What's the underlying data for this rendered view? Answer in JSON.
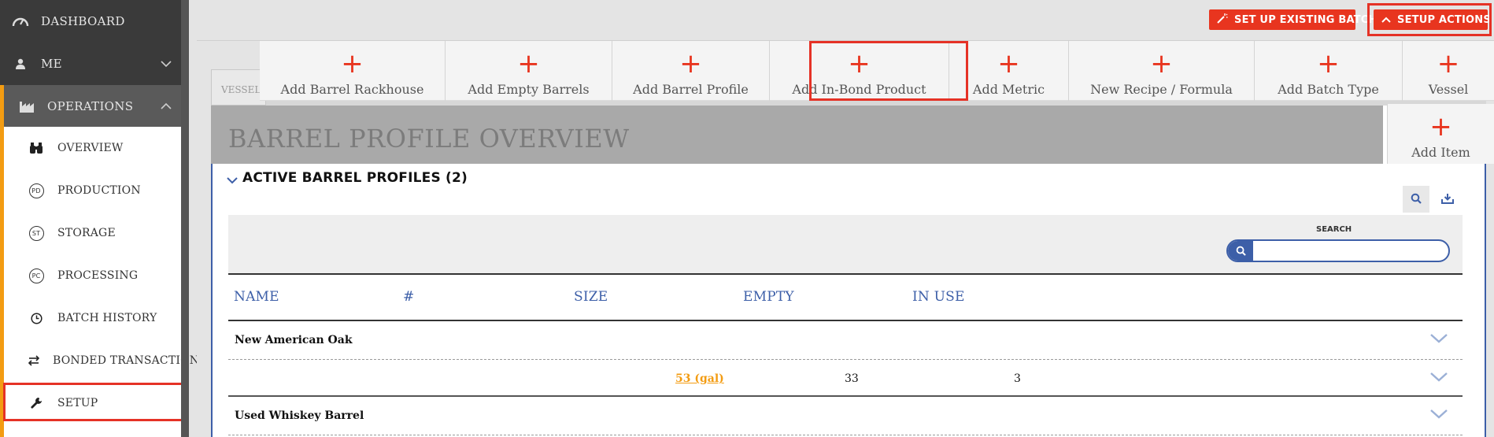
{
  "sidebar": {
    "items": [
      {
        "label": "DASHBOARD",
        "icon": "speedometer-icon"
      },
      {
        "label": "ME",
        "icon": "user-icon"
      },
      {
        "label": "OPERATIONS",
        "icon": "factory-icon"
      }
    ],
    "sub_items": [
      {
        "label": "OVERVIEW",
        "icon": "binoculars-icon"
      },
      {
        "label": "PRODUCTION",
        "badge": "PD"
      },
      {
        "label": "STORAGE",
        "badge": "ST"
      },
      {
        "label": "PROCESSING",
        "badge": "PC"
      },
      {
        "label": "BATCH HISTORY",
        "icon": "clock-icon"
      },
      {
        "label": "BONDED TRANSACTIONS",
        "icon": "transfer-icon"
      },
      {
        "label": "SETUP",
        "icon": "wrench-icon"
      }
    ]
  },
  "topbar": {
    "existing_batch": "SET UP EXISTING BATCH",
    "setup_actions": "SETUP ACTIONS"
  },
  "quick_add": [
    {
      "label": "Add Barrel Rackhouse"
    },
    {
      "label": "Add Empty Barrels"
    },
    {
      "label": "Add Barrel Profile"
    },
    {
      "label": "Add In-Bond Product"
    },
    {
      "label": "Add Metric"
    },
    {
      "label": "New Recipe / Formula"
    },
    {
      "label": "Add Batch Type"
    },
    {
      "label": "Vessel"
    },
    {
      "label": "Add Item"
    }
  ],
  "background_tab": "VESSEL",
  "page": {
    "title": "BARREL PROFILE OVERVIEW",
    "section_title": "ACTIVE BARREL PROFILES (2)"
  },
  "search": {
    "label": "SEARCH",
    "value": "",
    "placeholder": ""
  },
  "table": {
    "columns": [
      "NAME",
      "#",
      "SIZE",
      "EMPTY",
      "IN USE"
    ],
    "groups": [
      {
        "name": "New American Oak",
        "rows": [
          {
            "size": "53 (gal)",
            "empty": "33",
            "in_use": "3"
          }
        ]
      },
      {
        "name": "Used Whiskey Barrel"
      }
    ]
  },
  "colors": {
    "accent": "#e8351f",
    "highlight": "#e53226",
    "link": "#3d5fa8",
    "sidebar_active": "#f39c12"
  }
}
